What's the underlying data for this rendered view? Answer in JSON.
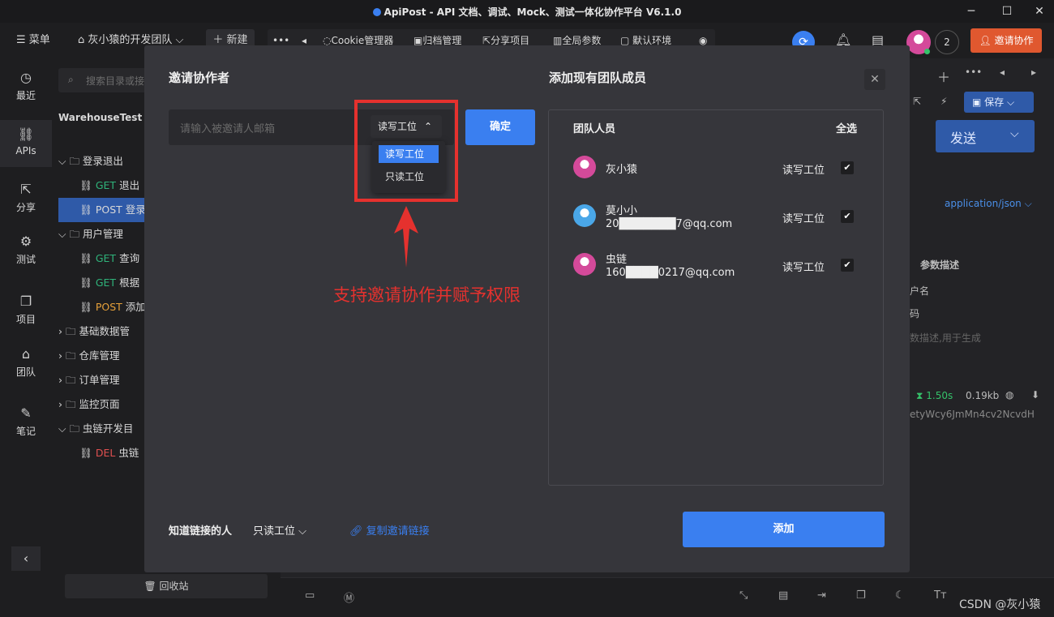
{
  "titlebar": {
    "title": "ApiPost - API 文档、调试、Mock、测试一体化协作平台 V6.1.0"
  },
  "toolbar": {
    "menu": "☰ 菜单",
    "team": "灰小猿的开发团队",
    "new_btn": "＋ 新建",
    "cookie": "Cookie管理器",
    "archive": "归档管理",
    "share": "分享项目",
    "global_params": "全局参数",
    "env": "默认环境",
    "member_count": "2",
    "invite_btn": "邀请协作"
  },
  "leftnav": {
    "items": [
      "最近",
      "APIs",
      "分享",
      "测试",
      "项目",
      "团队",
      "笔记"
    ]
  },
  "tree": {
    "search_placeholder": "搜索目录或接",
    "project": "WarehouseTest",
    "rows": [
      {
        "kind": "folder",
        "label": "登录退出"
      },
      {
        "kind": "api",
        "method": "GET",
        "label": "退出"
      },
      {
        "kind": "api",
        "method": "POST",
        "label": "登录"
      },
      {
        "kind": "folder",
        "label": "用户管理"
      },
      {
        "kind": "api",
        "method": "GET",
        "label": "查询"
      },
      {
        "kind": "api",
        "method": "GET",
        "label": "根据"
      },
      {
        "kind": "api",
        "method": "POST",
        "label": "添加"
      },
      {
        "kind": "folder",
        "label": "基础数据管"
      },
      {
        "kind": "folder",
        "label": "仓库管理"
      },
      {
        "kind": "folder",
        "label": "订单管理"
      },
      {
        "kind": "folder",
        "label": "监控页面"
      },
      {
        "kind": "folder",
        "label": "虫链开发目"
      },
      {
        "kind": "api",
        "method": "DEL",
        "label": "虫链"
      }
    ],
    "trash": "回收站"
  },
  "modal": {
    "invite_title": "邀请协作者",
    "email_placeholder": "请输入被邀请人邮箱",
    "perm_selected": "读写工位",
    "perm_options": [
      "读写工位",
      "只读工位"
    ],
    "confirm": "确定",
    "annotation": "支持邀请协作并赋予权限",
    "add_title": "添加现有团队成员",
    "members_header": "团队人员",
    "select_all": "全选",
    "members": [
      {
        "name": "灰小猿",
        "email": "",
        "perm": "读写工位",
        "color": "#d44a9a"
      },
      {
        "name": "莫小小",
        "email": "20███████7@qq.com",
        "perm": "读写工位",
        "color": "#4aa7e8"
      },
      {
        "name": "虫链",
        "email": "160████0217@qq.com",
        "perm": "读写工位",
        "color": "#d44a9a"
      }
    ],
    "link_label": "知道链接的人",
    "link_perm": "只读工位",
    "copy_link": "复制邀请链接",
    "add_btn": "添加"
  },
  "right": {
    "save": "保存",
    "send": "发送",
    "content_type": "application/json",
    "param_desc": "参数描述",
    "row1": "户名",
    "row2": "码",
    "row3": "数描述,用于生成",
    "time": "1.50s",
    "size": "0.19kb",
    "token": "etyWcy6JmMn4cv2NcvdH"
  },
  "watermark": "CSDN @灰小猿"
}
